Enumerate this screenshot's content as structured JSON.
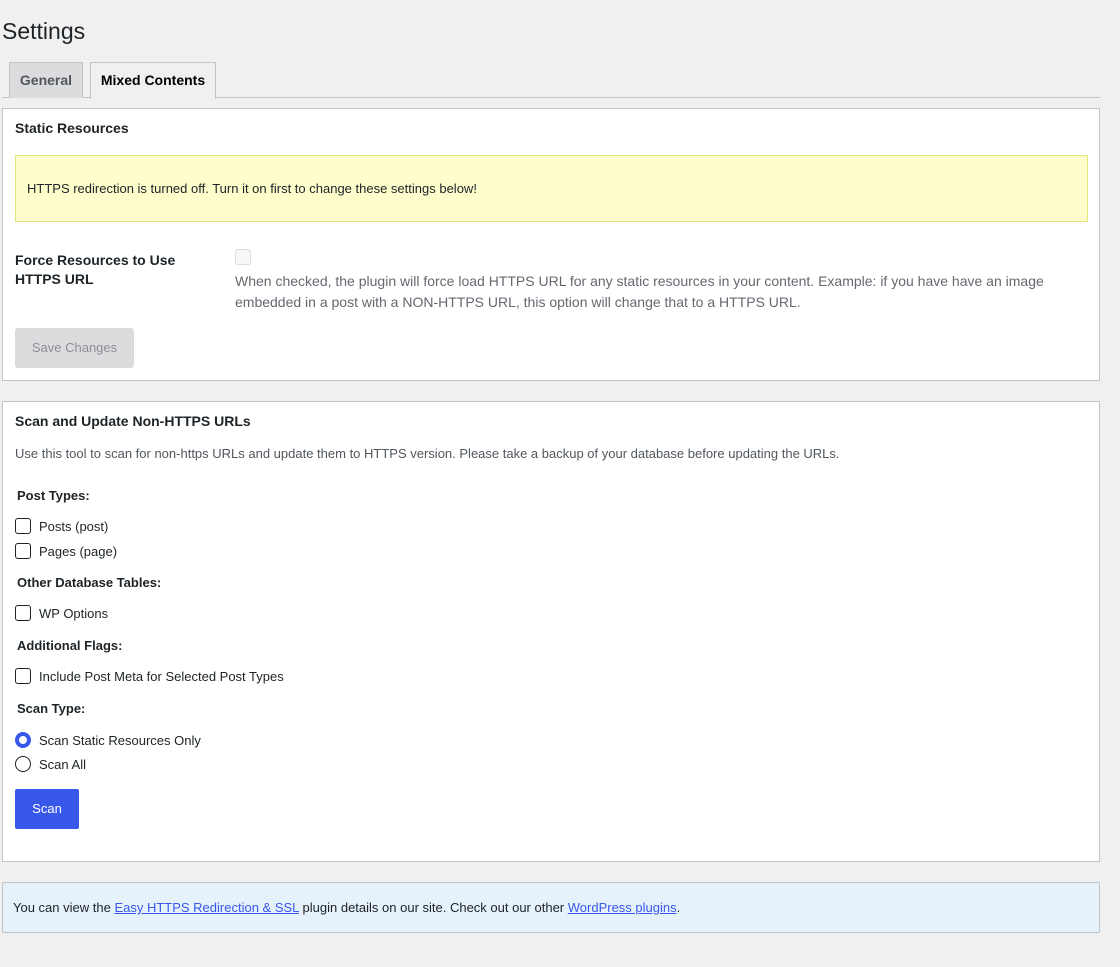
{
  "page": {
    "title": "Settings"
  },
  "tabs": [
    {
      "label": "General",
      "active": false
    },
    {
      "label": "Mixed Contents",
      "active": true
    }
  ],
  "static_resources": {
    "heading": "Static Resources",
    "notice": "HTTPS redirection is turned off. Turn it on first to change these settings below!",
    "force_label": "Force Resources to Use HTTPS URL",
    "force_checked": false,
    "force_disabled": true,
    "force_description": "When checked, the plugin will force load HTTPS URL for any static resources in your content. Example: if you have have an image embedded in a post with a NON-HTTPS URL, this option will change that to a HTTPS URL.",
    "save_label": "Save Changes"
  },
  "scan": {
    "heading": "Scan and Update Non-HTTPS URLs",
    "intro": "Use this tool to scan for non-https URLs and update them to HTTPS version. Please take a backup of your database before updating the URLs.",
    "post_types_label": "Post Types:",
    "post_types": [
      {
        "label": "Posts (post)",
        "checked": false
      },
      {
        "label": "Pages (page)",
        "checked": false
      }
    ],
    "other_tables_label": "Other Database Tables:",
    "other_tables": [
      {
        "label": "WP Options",
        "checked": false
      }
    ],
    "additional_flags_label": "Additional Flags:",
    "additional_flags": [
      {
        "label": "Include Post Meta for Selected Post Types",
        "checked": false
      }
    ],
    "scan_type_label": "Scan Type:",
    "scan_types": [
      {
        "label": "Scan Static Resources Only",
        "checked": true
      },
      {
        "label": "Scan All",
        "checked": false
      }
    ],
    "scan_button": "Scan"
  },
  "footer_notice": {
    "text_before": "You can view the ",
    "link1": "Easy HTTPS Redirection & SSL",
    "text_middle": " plugin details on our site. Check out our other ",
    "link2": "WordPress plugins",
    "text_after": "."
  },
  "colors": {
    "accent": "#3858e9",
    "warning_bg": "#fefecc",
    "info_bg": "#e5f1fb",
    "page_bg": "#f0f0f1"
  }
}
